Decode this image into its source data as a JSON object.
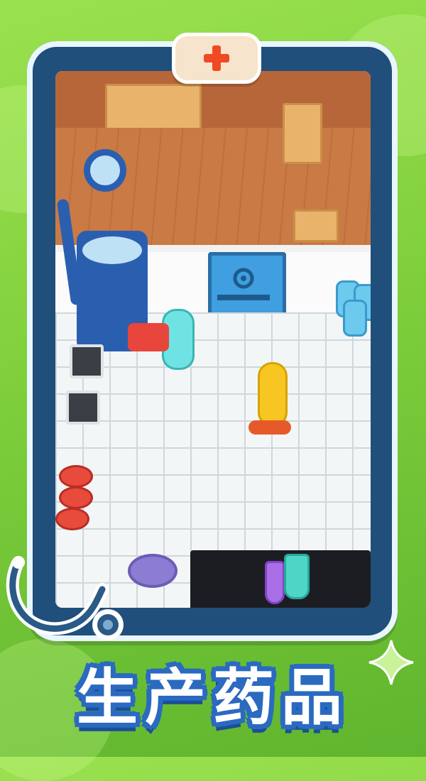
{
  "banner": {
    "title": "生产药品"
  },
  "icons": {
    "badge": "red-cross-icon",
    "stethoscope": "stethoscope-icon",
    "sparkle": "sparkle-icon",
    "door_symbol": "biohazard-icon"
  },
  "colors": {
    "background": "#7fcf3c",
    "frame": "#1f4f7a",
    "cross": "#ef4a24",
    "title_text": "#ffffff",
    "title_outline": "#2a6ac0"
  }
}
